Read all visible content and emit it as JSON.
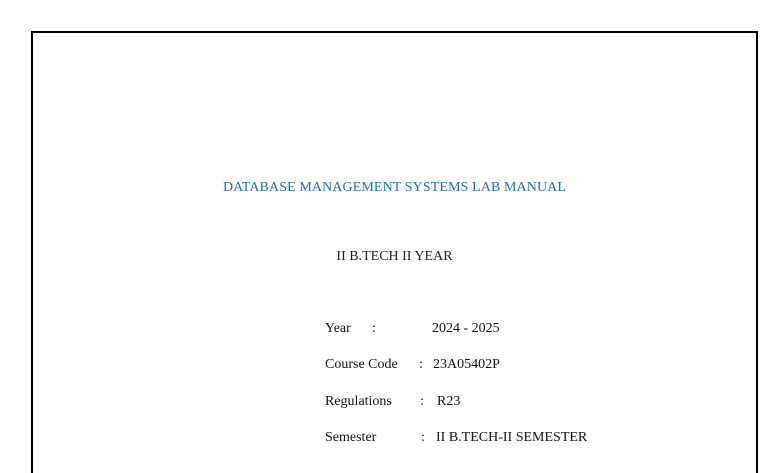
{
  "document": {
    "title": "DATABASE MANAGEMENT SYSTEMS LAB MANUAL",
    "subtitle": "II B.TECH II YEAR",
    "details": [
      {
        "label": "Year",
        "separator": ":",
        "value": "2024 - 2025"
      },
      {
        "label": "Course Code",
        "separator": ":",
        "value": "23A05402P"
      },
      {
        "label": "Regulations",
        "separator": ":",
        "value": "R23"
      },
      {
        "label": "Semester",
        "separator": ":",
        "value": "II B.TECH-II SEMESTER"
      }
    ]
  },
  "colors": {
    "title": "#1f6fb5",
    "text": "#111111",
    "border": "#000000"
  }
}
